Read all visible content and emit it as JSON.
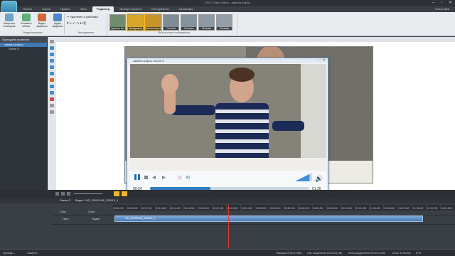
{
  "window": {
    "title": "VSDC Video Editor - замена кофты"
  },
  "menu": {
    "tabs": [
      "Проект",
      "Сцена",
      "Правка",
      "Окно",
      "Редактор",
      "Экспорт проекта",
      "Инструменты",
      "Активация"
    ],
    "active": "Редактор",
    "help": "Настройки"
  },
  "ribbon": {
    "run_label": "Запустить помощник",
    "insert_label": "Вставить объект",
    "video_fx_label": "Видео эффекты",
    "audio_fx_label": "Аудио эффекты",
    "group_editing": "Редактирование",
    "delete_split": "Удаление и разбивка",
    "group_tools": "Инструменты",
    "group_styles": "Выбор стиля отображения",
    "effects": [
      "Удалить все",
      "Автоуровни",
      "Автоконтраст",
      "Оттенки",
      "Оттенки",
      "Оттенки",
      "Оттенки"
    ]
  },
  "project_tree": {
    "header": "Проводник проектов",
    "items": [
      "замена кофты",
      "Scene 0"
    ]
  },
  "player": {
    "title": "замена кофты: Scene 0",
    "time_current": "00:54",
    "time_total": "01:26",
    "progress": 0.38,
    "volume": 0.85
  },
  "timeline": {
    "tabs": [
      "Scene 0",
      "Видео: VID_20190418_123815_1"
    ],
    "track_header": [
      "Слои",
      "Слое"
    ],
    "track_name": "Наст...",
    "track_type": "Видео",
    "clip_label": "VID_20190418_123815_1",
    "ruler": [
      "00:00.000",
      "00:03.600",
      "00:07.200",
      "00:10.800",
      "00:14.400",
      "00:18.000",
      "00:21.600",
      "00:25.200",
      "00:28.800",
      "00:32.400",
      "00:36.000",
      "00:39.600",
      "00:43.200",
      "00:46.800",
      "00:50.400",
      "00:54.000",
      "00:57.600",
      "01:01.200",
      "01:04.800",
      "01:08.400",
      "01:12.000",
      "01:15.600",
      "01:19.200",
      "01:22.800"
    ]
  },
  "statusbar": {
    "left_tabs": [
      "Проводн...",
      "Свойств..."
    ],
    "position": "Позиция  00:00:31.866",
    "start_sel": "Нач. выделения  00:00:23.166",
    "end_sel": "Конец выделения  00:00:23.166",
    "zoom_label": "Zoom To Screen",
    "zoom": "57%"
  }
}
